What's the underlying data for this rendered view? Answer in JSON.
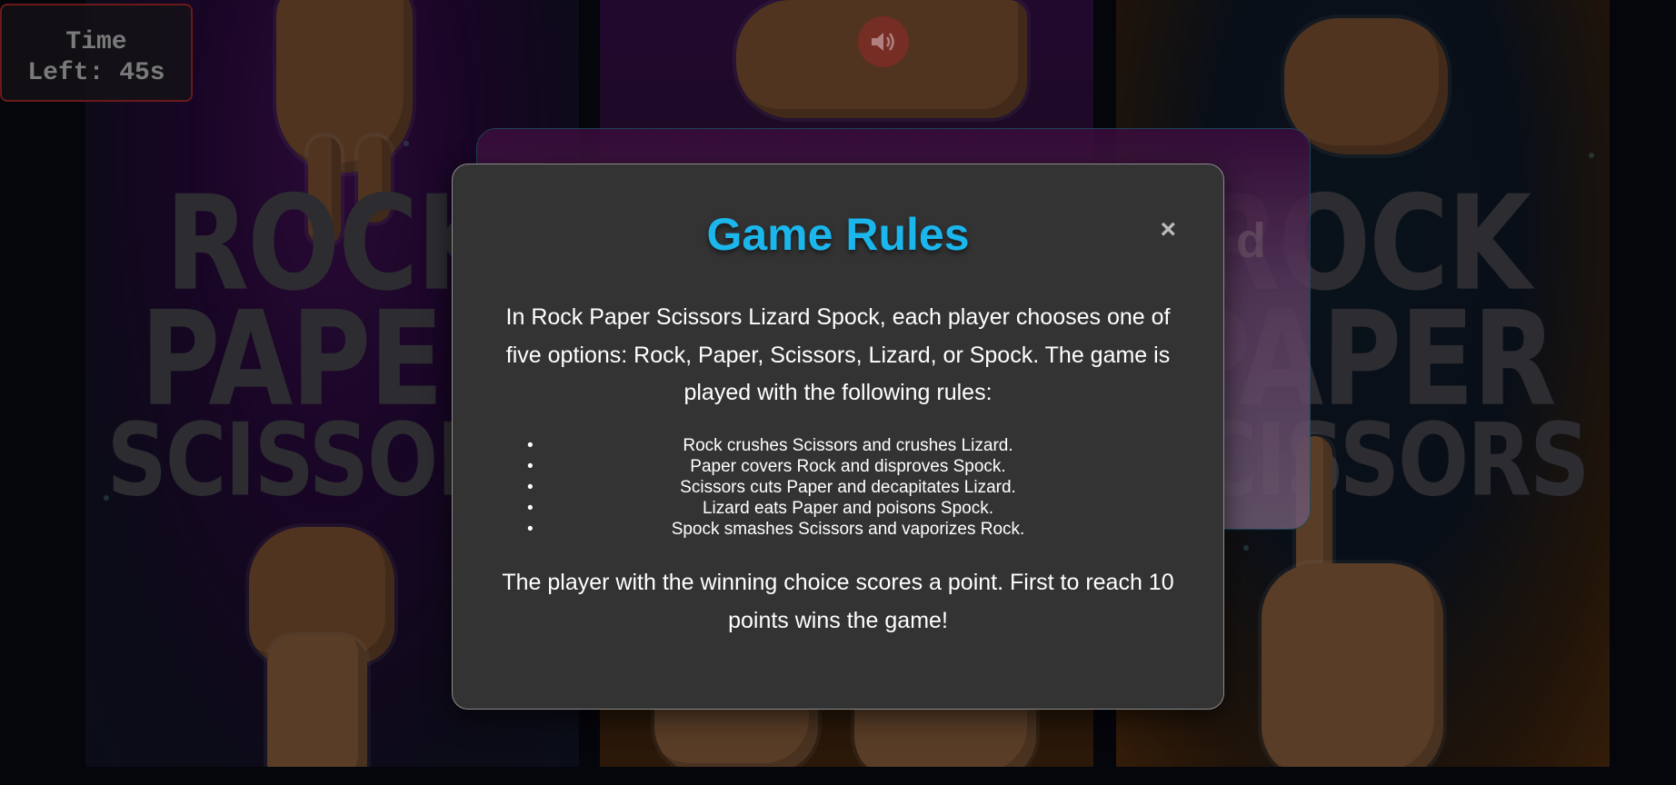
{
  "timer": {
    "line1": "Time",
    "line2": "Left: 45s"
  },
  "background": {
    "poster_left": [
      "ROCK",
      "PAPER",
      "SCISSORS"
    ],
    "poster_right": [
      "ROCK",
      "PAPER",
      "SCISSORS"
    ],
    "back_card_text": "d"
  },
  "sound_button": {
    "icon": "speaker-icon"
  },
  "modal": {
    "title": "Game Rules",
    "close_label": "×",
    "intro": "In Rock Paper Scissors Lizard Spock, each player chooses one of five options: Rock, Paper, Scissors, Lizard, or Spock. The game is played with the following rules:",
    "rules": [
      "Rock crushes Scissors and crushes Lizard.",
      "Paper covers Rock and disproves Spock.",
      "Scissors cuts Paper and decapitates Lizard.",
      "Lizard eats Paper and poisons Spock.",
      "Spock smashes Scissors and vaporizes Rock."
    ],
    "outro": "The player with the winning choice scores a point. First to reach 10 points wins the game!"
  },
  "colors": {
    "title": "#1ab6ec",
    "modal_bg": "#333333",
    "page_bg": "#0a0a16"
  }
}
